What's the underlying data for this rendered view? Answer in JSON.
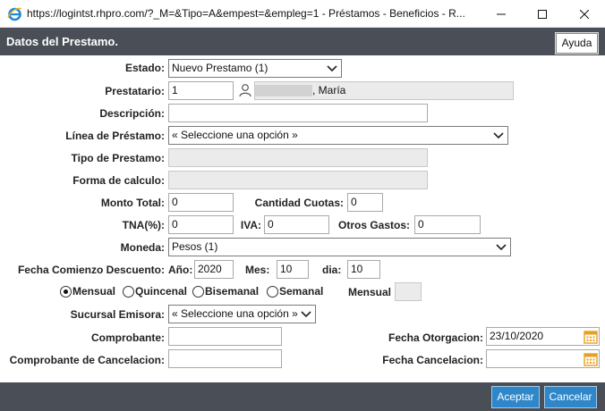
{
  "window": {
    "title": "https://logintst.rhpro.com/?_M=&Tipo=A&empest=&empleg=1 - Préstamos - Beneficios - R...",
    "minimize_icon": "minimize-icon",
    "maximize_icon": "maximize-icon",
    "close_icon": "close-icon"
  },
  "header": {
    "title": "Datos del Prestamo.",
    "help_label": "Ayuda"
  },
  "form": {
    "estado": {
      "label": "Estado:",
      "value": "Nuevo Prestamo (1)"
    },
    "prestatario": {
      "label": "Prestatario:",
      "code": "1",
      "name": ", María",
      "icon": "person-icon"
    },
    "descripcion": {
      "label": "Descripción:",
      "value": ""
    },
    "linea": {
      "label": "Línea de Préstamo:",
      "value": "« Seleccione una opción »"
    },
    "tipo": {
      "label": "Tipo de Prestamo:",
      "value": ""
    },
    "forma": {
      "label": "Forma de calculo:",
      "value": ""
    },
    "monto": {
      "label": "Monto Total:",
      "value": "0"
    },
    "cuotas": {
      "label": "Cantidad Cuotas:",
      "value": "0"
    },
    "tna": {
      "label": "TNA(%):",
      "value": "0"
    },
    "iva": {
      "label": "IVA:",
      "value": "0"
    },
    "otros": {
      "label": "Otros Gastos:",
      "value": "0"
    },
    "moneda": {
      "label": "Moneda:",
      "value": "Pesos (1)"
    },
    "fecha_desc": {
      "label": "Fecha Comienzo Descuento:",
      "anio_label": "Año:",
      "anio": "2020",
      "mes_label": "Mes:",
      "mes": "10",
      "dia_label": "dia:",
      "dia": "10"
    },
    "frecuencia": {
      "options": [
        "Mensual",
        "Quincenal",
        "Bisemanal",
        "Semanal"
      ],
      "selected": "Mensual",
      "readout_label": "Mensual",
      "readout_value": ""
    },
    "sucursal": {
      "label": "Sucursal Emisora:",
      "value": "« Seleccione una opción »"
    },
    "comprobante": {
      "label": "Comprobante:",
      "value": ""
    },
    "comprobante_canc": {
      "label": "Comprobante de Cancelacion:",
      "value": ""
    },
    "fecha_otorg": {
      "label": "Fecha Otorgacion:",
      "value": "23/10/2020",
      "icon": "calendar-icon"
    },
    "fecha_canc": {
      "label": "Fecha Cancelacion:",
      "value": "",
      "icon": "calendar-icon"
    }
  },
  "footer": {
    "accept_label": "Aceptar",
    "cancel_label": "Cancelar"
  },
  "colors": {
    "header_bg": "#4a4f57",
    "button_bg": "#2f86c8",
    "calendar_accent": "#e8a020"
  }
}
